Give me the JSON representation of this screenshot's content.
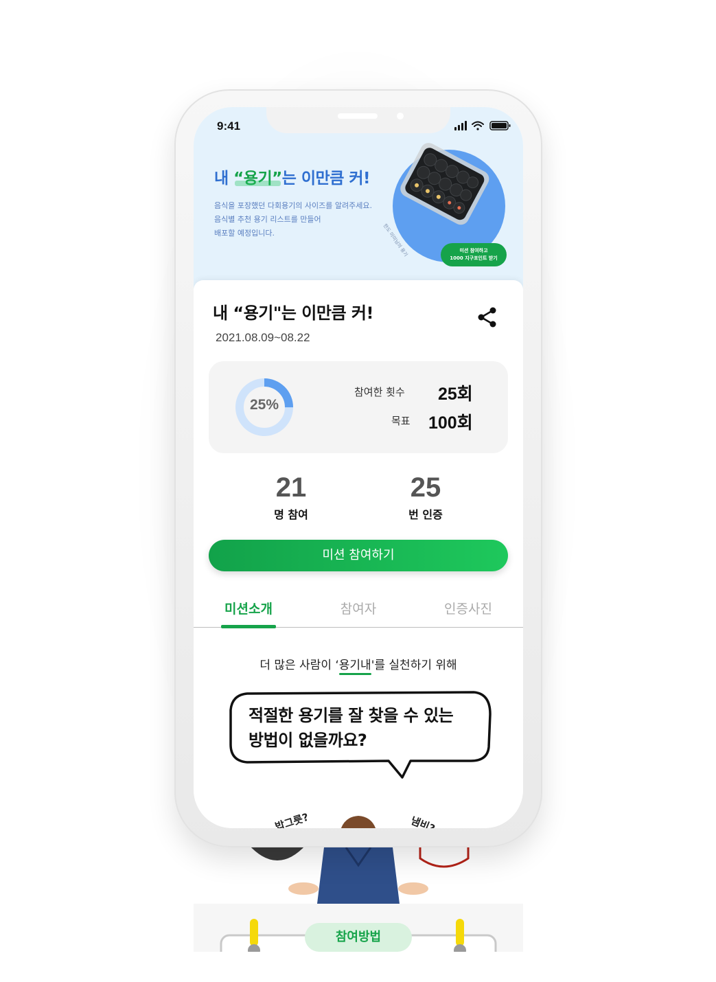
{
  "status_bar": {
    "time": "9:41"
  },
  "banner": {
    "title_prefix": "내 ",
    "title_highlight": "“용기”",
    "title_suffix": "는 이만큼 커!",
    "description_lines": [
      "음식을 포장했던 다회용기의 사이즈를 알려주세요.",
      "음식별 추천 용기 리스트를 만들어",
      "배포할 예정입니다."
    ],
    "photo_caption": "한도 미미님의 용기",
    "badge_lines": [
      "미션 참여하고",
      "1000 지구포인트 받기"
    ]
  },
  "mission": {
    "title": "내 “용기\"는 이만큼 커!",
    "period": "2021.08.09~08.22",
    "progress_percent": 25,
    "progress_label": "25%",
    "participation_label": "참여한 횟수",
    "participation_value": "25회",
    "goal_label": "목표",
    "goal_value": "100회",
    "participants_count": "21",
    "participants_label": "명 참여",
    "certifications_count": "25",
    "certifications_label": "번 인증",
    "join_button": "미션 참여하기"
  },
  "tabs": [
    {
      "label": "미션소개",
      "active": true
    },
    {
      "label": "참여자",
      "active": false
    },
    {
      "label": "인증사진",
      "active": false
    }
  ],
  "intro": {
    "lead_before": "더 많은 사람이 ‘",
    "lead_highlight": "용기내",
    "lead_after": "'를 실천하기 위해",
    "bubble_line1": "적절한 용기를 잘 찾을 수 있는",
    "bubble_line2": "방법이 없을까요?",
    "left_hand_label": "밥그릇?",
    "right_hand_label": "냄비?",
    "method_label": "참여방법"
  },
  "colors": {
    "brand_green": "#16a34a",
    "banner_bg": "#e4f2fc",
    "banner_blue": "#2f6fd0",
    "progress_blue": "#5e9ff0"
  }
}
